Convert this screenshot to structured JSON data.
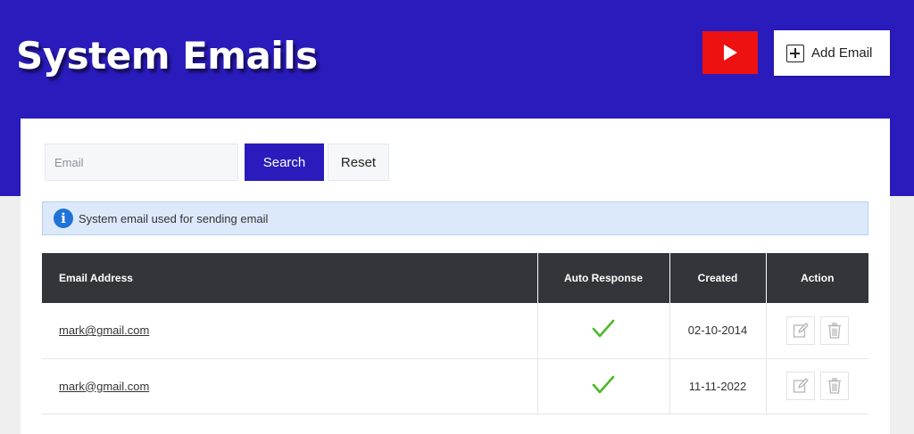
{
  "header": {
    "title": "System Emails",
    "add_email_label": "Add Email",
    "play_button_icon": "play-icon",
    "accent_color": "#2a1bbc",
    "play_button_color": "#ee1111"
  },
  "search": {
    "placeholder": "Email",
    "value": "",
    "search_label": "Search",
    "reset_label": "Reset"
  },
  "info": {
    "icon": "info-icon",
    "text": "System email used for sending email"
  },
  "table": {
    "columns": [
      "Email Address",
      "Auto Response",
      "Created",
      "Action"
    ],
    "rows": [
      {
        "email": "mark@gmail.com",
        "auto_response": true,
        "created": "02-10-2014"
      },
      {
        "email": "mark@gmail.com",
        "auto_response": true,
        "created": "11-11-2022"
      }
    ],
    "action_icons": [
      "edit-icon",
      "trash-icon"
    ]
  }
}
